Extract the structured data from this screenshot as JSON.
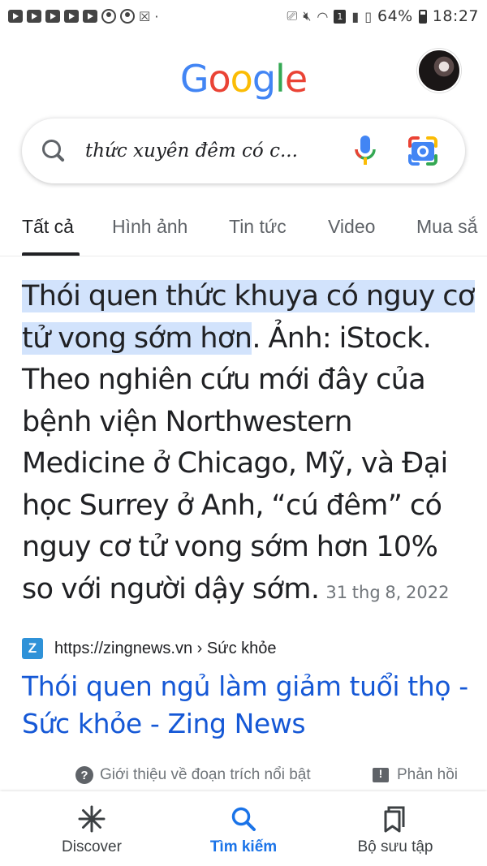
{
  "status_bar": {
    "battery": "64%",
    "time": "18:27",
    "sim_slot": "1"
  },
  "header": {
    "logo_letters": [
      "G",
      "o",
      "o",
      "g",
      "l",
      "e"
    ],
    "logo_colors": [
      "#4285f4",
      "#ea4335",
      "#fbbc05",
      "#4285f4",
      "#34a853",
      "#ea4335"
    ]
  },
  "search": {
    "query": "thức xuyên đêm có c..."
  },
  "tabs": [
    {
      "label": "Tất cả",
      "active": true
    },
    {
      "label": "Hình ảnh"
    },
    {
      "label": "Tin tức"
    },
    {
      "label": "Video"
    },
    {
      "label": "Mua sắ"
    }
  ],
  "snippet": {
    "highlighted": "Thói quen thức khuya có nguy cơ tử vong sớm hơn",
    "body": ". Ảnh: iStock. Theo nghiên cứu mới đây của bệnh viện Northwestern Medicine ở Chicago, Mỹ, và Đại học Surrey ở Anh, “cú đêm” có nguy cơ tử vong sớm hơn 10% so với người dậy sớm.",
    "date": "31 thg 8, 2022"
  },
  "result": {
    "favicon_letter": "Z",
    "source_url": "https://zingnews.vn › Sức khỏe",
    "title": "Thói quen ngủ làm giảm tuổi thọ - Sức khỏe - Zing News"
  },
  "footer": {
    "about_label": "Giới thiệu về đoạn trích nổi bật",
    "feedback_label": "Phản hồi"
  },
  "bottom_nav": {
    "discover": "Discover",
    "search": "Tìm kiếm",
    "collections": "Bộ sưu tập"
  },
  "colors": {
    "link": "#1558d6",
    "highlight": "#d2e3fc",
    "active_nav": "#1a73e8"
  }
}
